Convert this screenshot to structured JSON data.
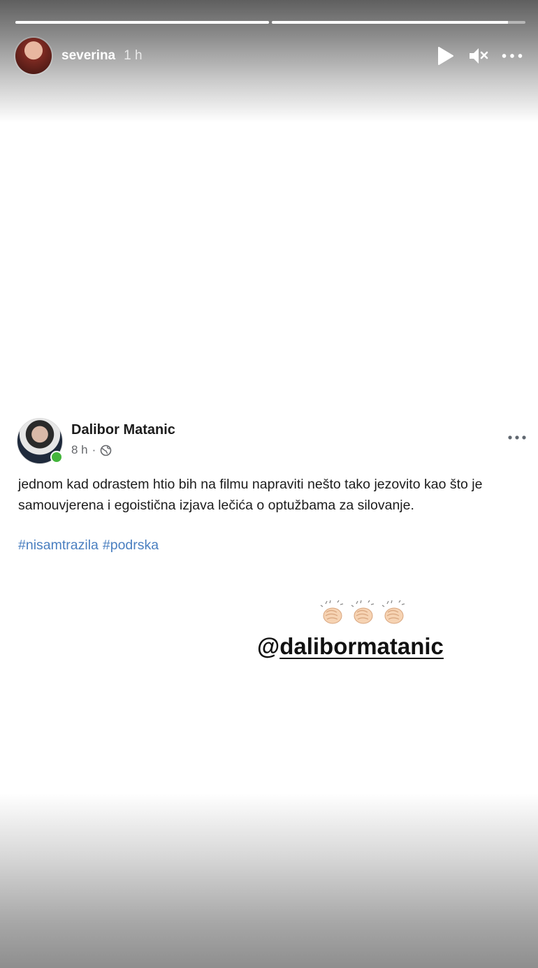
{
  "story": {
    "username": "severina",
    "time": "1 h",
    "progress": [
      1.0,
      0.93
    ]
  },
  "controls": {
    "play_icon": "play-icon",
    "mute_icon": "mute-icon",
    "more_icon": "more-icon"
  },
  "post": {
    "author": "Dalibor Matanic",
    "time": "8 h",
    "separator": "·",
    "privacy_icon": "globe-icon",
    "text": "jednom kad odrastem htio bih na filmu napraviti nešto tako jezovito kao što je samouvjerena i egoistična izjava lečića o optužbama za silovanje.",
    "hashtags": [
      "#nisamtrazila",
      "#podrska"
    ]
  },
  "sticker": {
    "claps": [
      "clap-icon",
      "clap-icon",
      "clap-icon"
    ],
    "mention_at": "@",
    "mention_handle": "dalibormatanic"
  },
  "colors": {
    "hashtag": "#4a7fc0",
    "online": "#44b53c"
  }
}
